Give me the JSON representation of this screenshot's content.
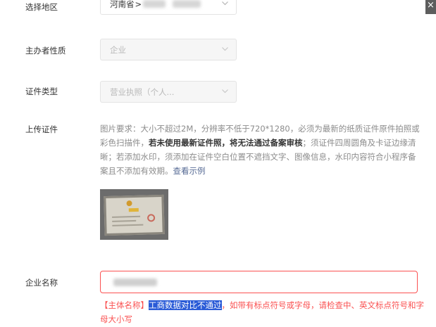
{
  "form": {
    "region": {
      "label": "选择地区",
      "province": "河南省",
      "separator": ">"
    },
    "organizer_type": {
      "label": "主办者性质",
      "value": "企业"
    },
    "certificate_type": {
      "label": "证件类型",
      "value": "营业执照（个人..."
    },
    "upload": {
      "label": "上传证件",
      "hint_part1": "图片要求：大小不超过2M，分辨率不低于720*1280，必须为最新的纸质证件原件拍照或彩色扫描件，",
      "hint_strong": "若未使用最新证件照，将无法通过备案审核",
      "hint_part2": "；须证件四周圆角及卡证边缘清晰；若添加水印，须添加在证件空白位置不遮挡文字、图像信息，水印内容符合小程序备案且不添加有效期。",
      "example_link": "查看示例"
    },
    "company_name": {
      "label": "企业名称",
      "error_prefix": "【主体名称】",
      "error_highlight": "工商数据对比不通过",
      "error_rest": "，如带有标点符号或字母，请检查中、英文标点符号和字母大小写"
    }
  },
  "side_close": {
    "glyph": "×"
  },
  "colors": {
    "error": "#fa5151",
    "link": "#576b95",
    "highlight_bg": "#2a5bd7",
    "disabled_bg": "#f6f6f6"
  }
}
